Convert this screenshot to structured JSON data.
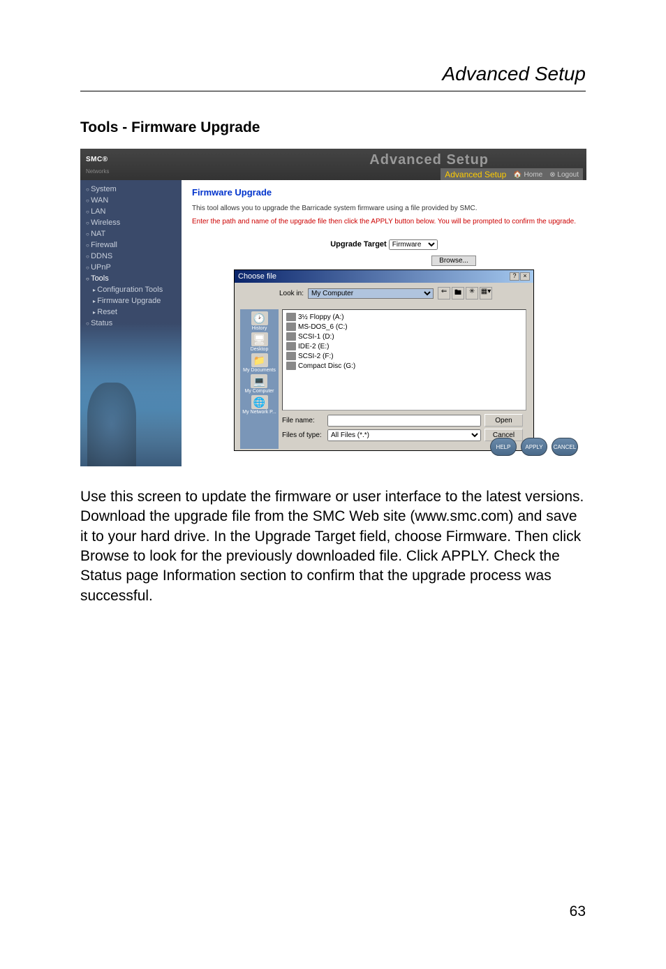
{
  "page": {
    "header": "Advanced Setup",
    "section_title": "Tools - Firmware Upgrade",
    "body_text": "Use this screen to update the firmware or user interface to the latest versions. Download the upgrade file from the SMC Web site (www.smc.com) and save it to your hard drive. In the Upgrade Target field, choose Firmware. Then click Browse to look for the previously downloaded file. Click APPLY. Check the Status page Information section to confirm that the upgrade process was successful.",
    "page_number": "63"
  },
  "screenshot": {
    "logo_text": "SMC",
    "logo_sub": "Networks",
    "brand_right": "Advanced Setup",
    "advanced_bar": {
      "label": "Advanced Setup",
      "home": "Home",
      "logout": "Logout"
    },
    "sidebar": {
      "items": [
        {
          "label": "System",
          "type": "top"
        },
        {
          "label": "WAN",
          "type": "top"
        },
        {
          "label": "LAN",
          "type": "top"
        },
        {
          "label": "Wireless",
          "type": "top"
        },
        {
          "label": "NAT",
          "type": "top"
        },
        {
          "label": "Firewall",
          "type": "top"
        },
        {
          "label": "DDNS",
          "type": "top"
        },
        {
          "label": "UPnP",
          "type": "top"
        },
        {
          "label": "Tools",
          "type": "top-active"
        },
        {
          "label": "Configuration Tools",
          "type": "sub"
        },
        {
          "label": "Firmware Upgrade",
          "type": "sub"
        },
        {
          "label": "Reset",
          "type": "sub"
        },
        {
          "label": "Status",
          "type": "top"
        }
      ]
    },
    "main": {
      "title": "Firmware Upgrade",
      "text1": "This tool allows you to upgrade the Barricade system firmware using a file provided by SMC.",
      "text2": "Enter the path and name of the upgrade file then click the APPLY button below. You will be prompted to confirm the upgrade.",
      "upgrade_target_label": "Upgrade Target",
      "upgrade_target_value": "Firmware",
      "browse_button": "Browse..."
    },
    "dialog": {
      "title": "Choose file",
      "lookin_label": "Look in:",
      "lookin_value": "My Computer",
      "places": [
        {
          "icon": "🕑",
          "label": "History"
        },
        {
          "icon": "🖥",
          "label": "Desktop"
        },
        {
          "icon": "📁",
          "label": "My Documents"
        },
        {
          "icon": "💻",
          "label": "My Computer"
        },
        {
          "icon": "🌐",
          "label": "My Network P..."
        }
      ],
      "drives": [
        "3½ Floppy (A:)",
        "MS-DOS_6 (C:)",
        "SCSI-1 (D:)",
        "IDE-2 (E:)",
        "SCSI-2 (F:)",
        "Compact Disc (G:)"
      ],
      "filename_label": "File name:",
      "filename_value": "",
      "filetype_label": "Files of type:",
      "filetype_value": "All Files (*.*)",
      "open_button": "Open",
      "cancel_button": "Cancel"
    },
    "action_buttons": {
      "help": "HELP",
      "apply": "APPLY",
      "cancel": "CANCEL"
    }
  }
}
